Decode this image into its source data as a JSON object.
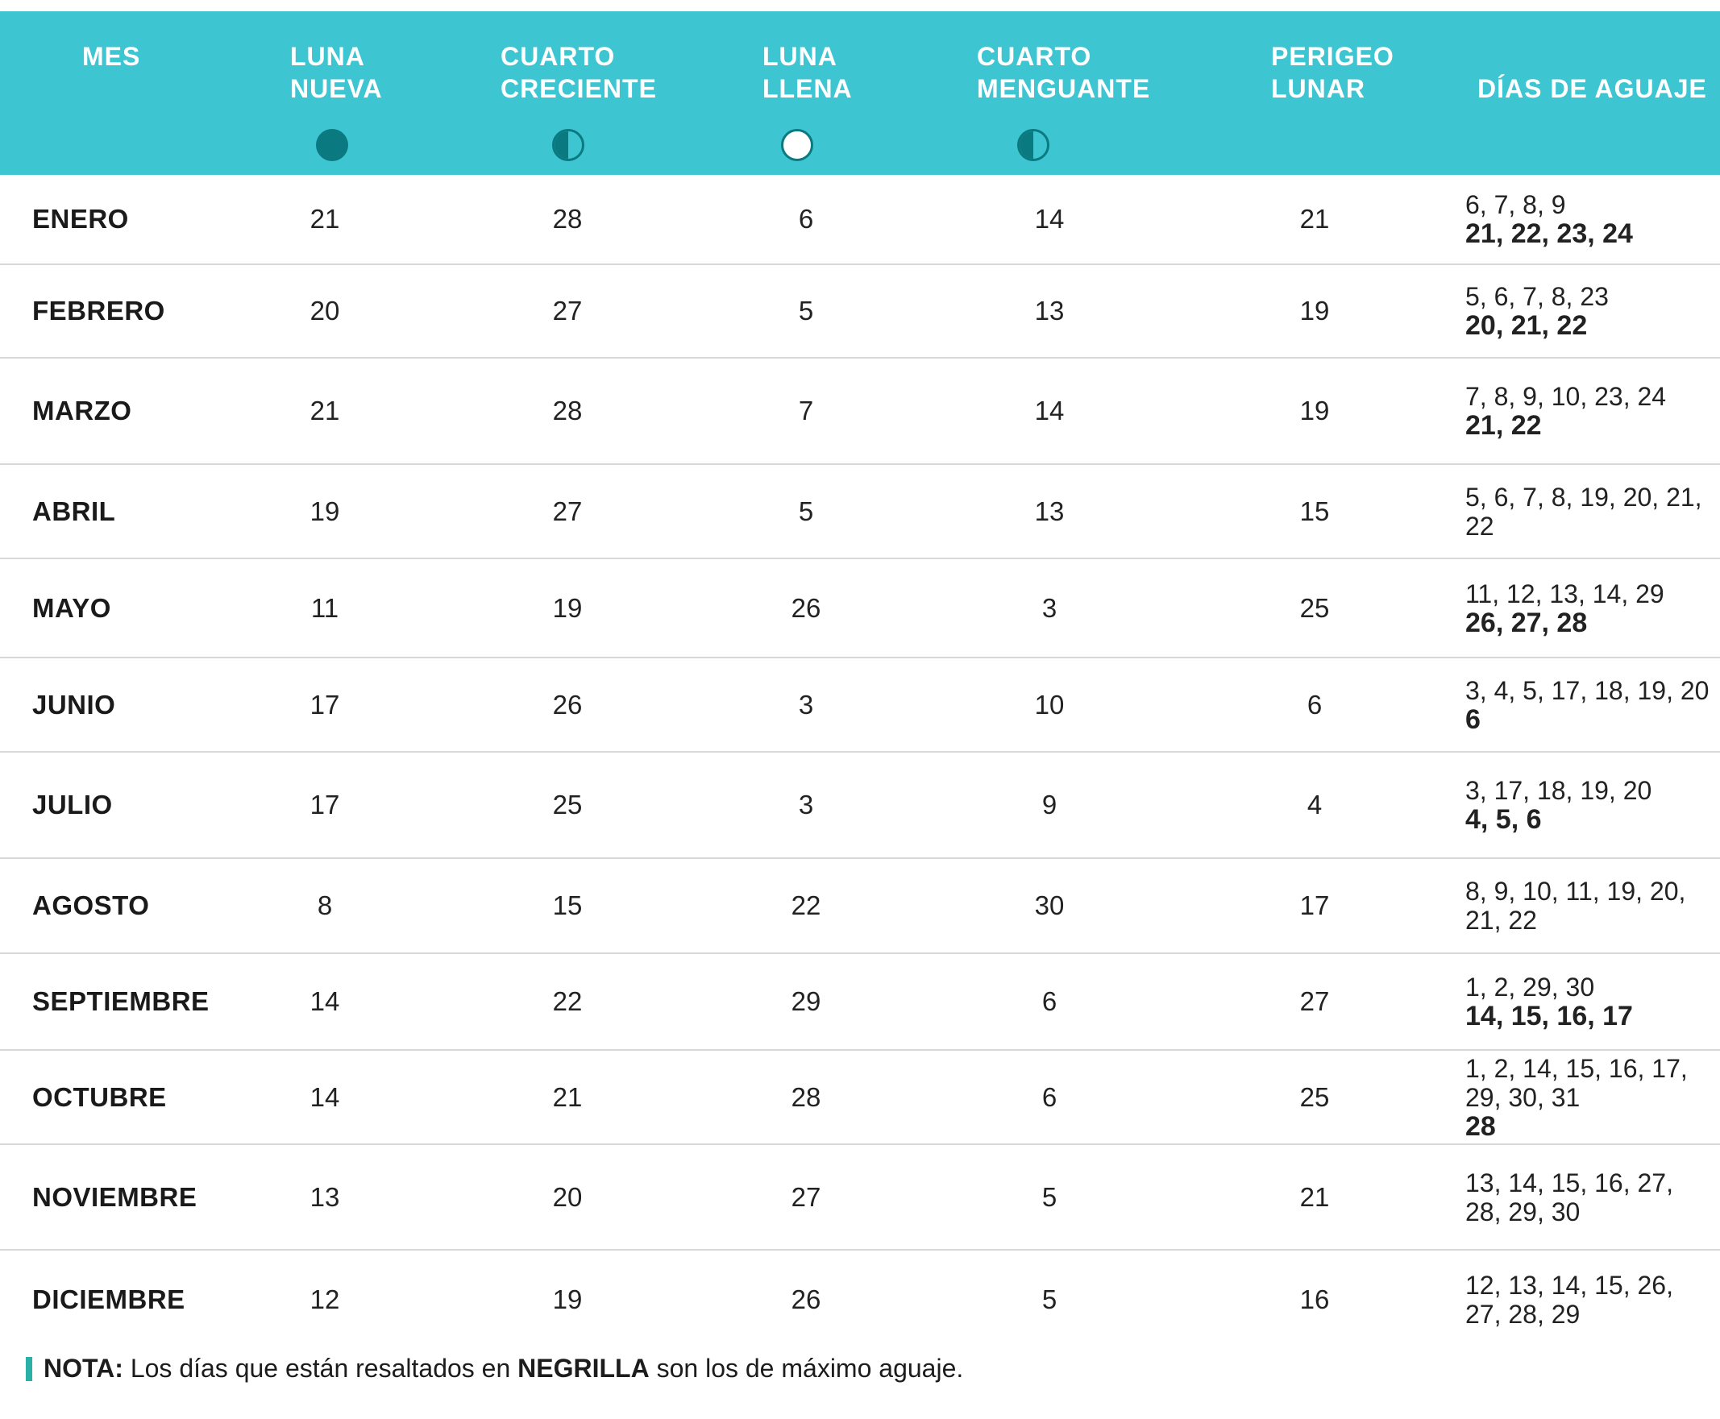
{
  "header": {
    "mes": [
      "MES"
    ],
    "luna_nueva": [
      "LUNA",
      "NUEVA"
    ],
    "cuarto_creciente": [
      "CUARTO",
      "CRECIENTE"
    ],
    "luna_llena": [
      "LUNA",
      "LLENA"
    ],
    "cuarto_menguante": [
      "CUARTO",
      "MENGUANTE"
    ],
    "perigeo": [
      "PERIGEO",
      "LUNAR"
    ],
    "aguaje": [
      "DÍAS DE AGUAJE"
    ],
    "icons": [
      "new-moon-icon",
      "first-quarter-moon-icon",
      "full-moon-icon",
      "last-quarter-moon-icon"
    ],
    "colors": {
      "header_bg": "#3ec5d2",
      "moon_dark": "#0a7a80",
      "header_text": "#ffffff"
    }
  },
  "rows": [
    {
      "mes": "ENERO",
      "luna_nueva": "21",
      "cuarto_creciente": "28",
      "luna_llena": "6",
      "cuarto_menguante": "14",
      "perigeo": "21",
      "aguaje_normal": "6, 7, 8, 9",
      "aguaje_bold": "21, 22, 23, 24"
    },
    {
      "mes": "FEBRERO",
      "luna_nueva": "20",
      "cuarto_creciente": "27",
      "luna_llena": "5",
      "cuarto_menguante": "13",
      "perigeo": "19",
      "aguaje_normal": "5, 6, 7, 8, 23",
      "aguaje_bold": "20, 21, 22"
    },
    {
      "mes": "MARZO",
      "luna_nueva": "21",
      "cuarto_creciente": "28",
      "luna_llena": "7",
      "cuarto_menguante": "14",
      "perigeo": "19",
      "aguaje_normal": "7, 8, 9, 10, 23, 24",
      "aguaje_bold": "21, 22"
    },
    {
      "mes": "ABRIL",
      "luna_nueva": "19",
      "cuarto_creciente": "27",
      "luna_llena": "5",
      "cuarto_menguante": "13",
      "perigeo": "15",
      "aguaje_normal": "5, 6, 7, 8, 19, 20, 21, 22",
      "aguaje_bold": ""
    },
    {
      "mes": "MAYO",
      "luna_nueva": "11",
      "cuarto_creciente": "19",
      "luna_llena": "26",
      "cuarto_menguante": "3",
      "perigeo": "25",
      "aguaje_normal": "11, 12, 13, 14, 29",
      "aguaje_bold": "26, 27, 28"
    },
    {
      "mes": "JUNIO",
      "luna_nueva": "17",
      "cuarto_creciente": "26",
      "luna_llena": "3",
      "cuarto_menguante": "10",
      "perigeo": "6",
      "aguaje_normal": "3, 4, 5, 17, 18, 19, 20",
      "aguaje_bold": "6"
    },
    {
      "mes": "JULIO",
      "luna_nueva": "17",
      "cuarto_creciente": "25",
      "luna_llena": "3",
      "cuarto_menguante": "9",
      "perigeo": "4",
      "aguaje_normal": "3, 17, 18, 19, 20",
      "aguaje_bold": "4, 5, 6"
    },
    {
      "mes": "AGOSTO",
      "luna_nueva": "8",
      "cuarto_creciente": "15",
      "luna_llena": "22",
      "cuarto_menguante": "30",
      "perigeo": "17",
      "aguaje_normal": "8, 9, 10, 11, 19, 20, 21, 22",
      "aguaje_bold": ""
    },
    {
      "mes": "SEPTIEMBRE",
      "luna_nueva": "14",
      "cuarto_creciente": "22",
      "luna_llena": "29",
      "cuarto_menguante": "6",
      "perigeo": "27",
      "aguaje_normal": "1, 2, 29, 30",
      "aguaje_bold": "14, 15, 16, 17"
    },
    {
      "mes": "OCTUBRE",
      "luna_nueva": "14",
      "cuarto_creciente": "21",
      "luna_llena": "28",
      "cuarto_menguante": "6",
      "perigeo": "25",
      "aguaje_normal": "1, 2, 14, 15, 16, 17, 29, 30, 31",
      "aguaje_bold": "28"
    },
    {
      "mes": "NOVIEMBRE",
      "luna_nueva": "13",
      "cuarto_creciente": "20",
      "luna_llena": "27",
      "cuarto_menguante": "5",
      "perigeo": "21",
      "aguaje_normal": "13, 14, 15, 16, 27, 28, 29, 30",
      "aguaje_bold": ""
    },
    {
      "mes": "DICIEMBRE",
      "luna_nueva": "12",
      "cuarto_creciente": "19",
      "luna_llena": "26",
      "cuarto_menguante": "5",
      "perigeo": "16",
      "aguaje_normal": "12, 13, 14, 15, 26, 27, 28, 29",
      "aguaje_bold": ""
    }
  ],
  "note": {
    "label": "NOTA:",
    "text_1": " Los días que están resaltados en ",
    "emph": "NEGRILLA",
    "text_2": " son los de máximo aguaje."
  }
}
